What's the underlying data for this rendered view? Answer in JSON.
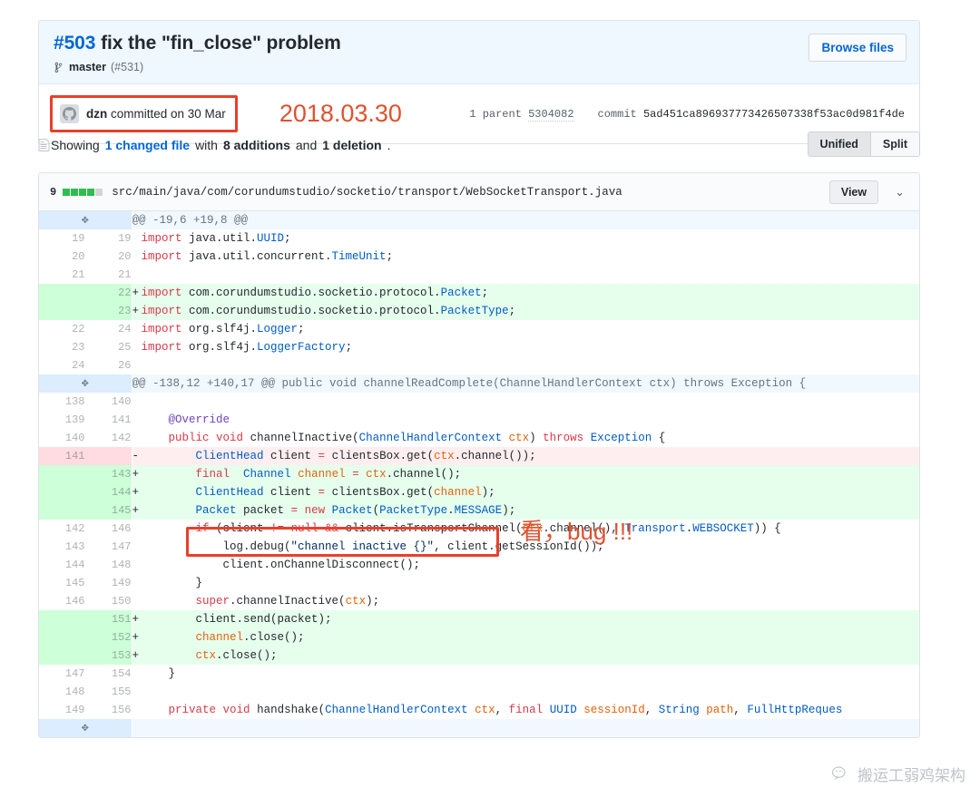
{
  "commit": {
    "number": "#503",
    "title": "fix the \"fin_close\" problem",
    "branch": "master",
    "pr_ref": "(#531)",
    "browse_files_label": "Browse files",
    "author": "dzn",
    "author_action": " committed on 30 Mar",
    "big_date": "2018.03.30",
    "parent_label": "1 parent",
    "parent_sha": "5304082",
    "commit_label": "commit",
    "commit_sha": "5ad451ca896937773426507338f53ac0d981f4de"
  },
  "summary": {
    "showing": "Showing",
    "changed_file": "1 changed file",
    "with": "with",
    "additions": "8 additions",
    "and": "and",
    "deletions": "1 deletion",
    "period": ".",
    "unified_label": "Unified",
    "split_label": "Split"
  },
  "file": {
    "change_count": "9",
    "path": "src/main/java/com/corundumstudio/socketio/transport/WebSocketTransport.java",
    "view_label": "View",
    "chevron": "⌄",
    "blocks": [
      "add",
      "add",
      "add",
      "add",
      "empty"
    ]
  },
  "annotations": {
    "bug_note": "看，bug !!!",
    "watermark": "搬运工弱鸡架构"
  },
  "diff": {
    "unfold_icon": "✥",
    "rows": [
      {
        "type": "hunk",
        "old": "",
        "new": "",
        "sign": "",
        "code": "@@ -19,6 +19,8 @@"
      },
      {
        "type": "ctx",
        "old": "19",
        "new": "19",
        "sign": "",
        "code": "import java.util.UUID;"
      },
      {
        "type": "ctx",
        "old": "20",
        "new": "20",
        "sign": "",
        "code": "import java.util.concurrent.TimeUnit;"
      },
      {
        "type": "ctx",
        "old": "21",
        "new": "21",
        "sign": "",
        "code": ""
      },
      {
        "type": "add",
        "old": "",
        "new": "22",
        "sign": "+",
        "code": "import com.corundumstudio.socketio.protocol.Packet;"
      },
      {
        "type": "add",
        "old": "",
        "new": "23",
        "sign": "+",
        "code": "import com.corundumstudio.socketio.protocol.PacketType;"
      },
      {
        "type": "ctx",
        "old": "22",
        "new": "24",
        "sign": "",
        "code": "import org.slf4j.Logger;"
      },
      {
        "type": "ctx",
        "old": "23",
        "new": "25",
        "sign": "",
        "code": "import org.slf4j.LoggerFactory;"
      },
      {
        "type": "ctx",
        "old": "24",
        "new": "26",
        "sign": "",
        "code": ""
      },
      {
        "type": "hunk",
        "old": "",
        "new": "",
        "sign": "",
        "code": "@@ -138,12 +140,17 @@ public void channelReadComplete(ChannelHandlerContext ctx) throws Exception {"
      },
      {
        "type": "ctx",
        "old": "138",
        "new": "140",
        "sign": "",
        "code": ""
      },
      {
        "type": "ctx",
        "old": "139",
        "new": "141",
        "sign": "",
        "code": "    @Override"
      },
      {
        "type": "ctx",
        "old": "140",
        "new": "142",
        "sign": "",
        "code": "    public void channelInactive(ChannelHandlerContext ctx) throws Exception {"
      },
      {
        "type": "del",
        "old": "141",
        "new": "",
        "sign": "-",
        "code": "        ClientHead client = clientsBox.get(ctx.channel());"
      },
      {
        "type": "add",
        "old": "",
        "new": "143",
        "sign": "+",
        "code": "        final  Channel channel = ctx.channel();"
      },
      {
        "type": "add",
        "old": "",
        "new": "144",
        "sign": "+",
        "code": "        ClientHead client = clientsBox.get(channel);"
      },
      {
        "type": "add",
        "old": "",
        "new": "145",
        "sign": "+",
        "code": "        Packet packet = new Packet(PacketType.MESSAGE);"
      },
      {
        "type": "ctx",
        "old": "142",
        "new": "146",
        "sign": "",
        "code": "        if (client != null && client.isTransportChannel(ctx.channel(), Transport.WEBSOCKET)) {"
      },
      {
        "type": "ctx",
        "old": "143",
        "new": "147",
        "sign": "",
        "code": "            log.debug(\"channel inactive {}\", client.getSessionId());"
      },
      {
        "type": "ctx",
        "old": "144",
        "new": "148",
        "sign": "",
        "code": "            client.onChannelDisconnect();"
      },
      {
        "type": "ctx",
        "old": "145",
        "new": "149",
        "sign": "",
        "code": "        }"
      },
      {
        "type": "ctx",
        "old": "146",
        "new": "150",
        "sign": "",
        "code": "        super.channelInactive(ctx);"
      },
      {
        "type": "add",
        "old": "",
        "new": "151",
        "sign": "+",
        "code": "        client.send(packet);"
      },
      {
        "type": "add",
        "old": "",
        "new": "152",
        "sign": "+",
        "code": "        channel.close();"
      },
      {
        "type": "add",
        "old": "",
        "new": "153",
        "sign": "+",
        "code": "        ctx.close();"
      },
      {
        "type": "ctx",
        "old": "147",
        "new": "154",
        "sign": "",
        "code": "    }"
      },
      {
        "type": "ctx",
        "old": "148",
        "new": "155",
        "sign": "",
        "code": ""
      },
      {
        "type": "ctx",
        "old": "149",
        "new": "156",
        "sign": "",
        "code": "    private void handshake(ChannelHandlerContext ctx, final UUID sessionId, String path, FullHttpReques"
      },
      {
        "type": "hunk",
        "old": "",
        "new": "",
        "sign": "",
        "code": ""
      }
    ]
  }
}
